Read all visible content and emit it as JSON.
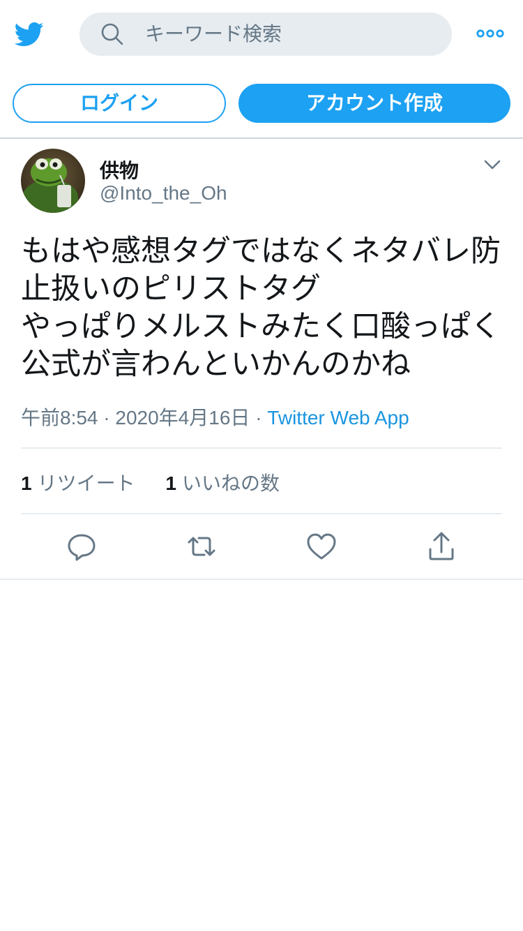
{
  "header": {
    "logo_icon": "twitter-bird-icon",
    "search_placeholder": "キーワード検索",
    "search_icon": "search-icon",
    "more_icon": "more-options-icon",
    "accent_color": "#1da1f2"
  },
  "auth": {
    "login_label": "ログイン",
    "signup_label": "アカウント作成"
  },
  "tweet": {
    "display_name": "供物",
    "handle": "@Into_the_Oh",
    "text": "もはや感想タグではなくネタバレ防止扱いのピリストタグ\nやっぱりメルストみたく口酸っぱく公式が言わんといかんのかね",
    "time": "午前8:54",
    "date": "2020年4月16日",
    "separator": "·",
    "source": "Twitter Web App",
    "retweets": {
      "count": "1",
      "label": "リツイート"
    },
    "likes": {
      "count": "1",
      "label": "いいねの数"
    },
    "actions": [
      "reply-icon",
      "retweet-icon",
      "like-icon",
      "share-icon"
    ]
  }
}
